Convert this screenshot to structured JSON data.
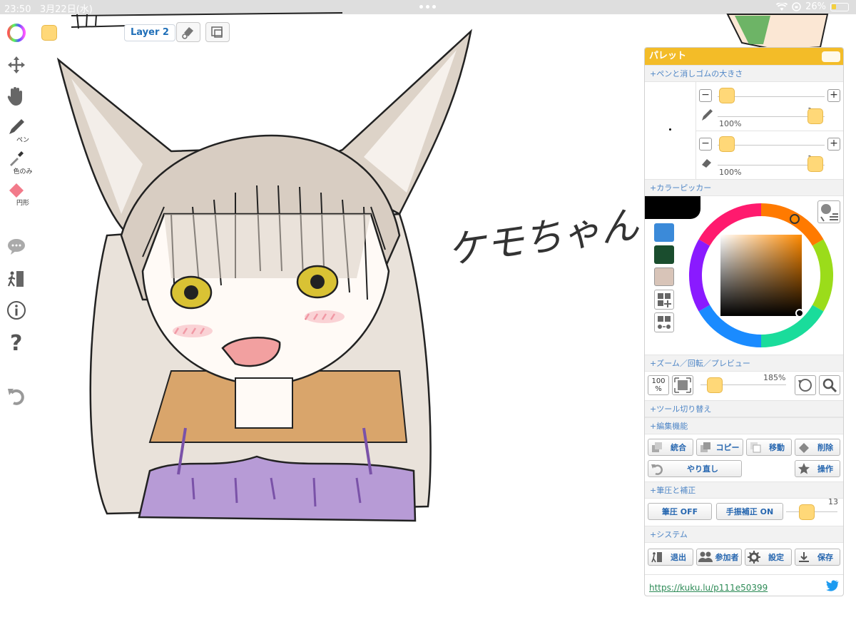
{
  "status": {
    "time": "23:50",
    "date": "3月22日(水)",
    "battery": "26%"
  },
  "toolbar": {
    "layer_label": "Layer 2",
    "color_swatch": "#ffd878"
  },
  "left_tools": {
    "pen_label": "ペン",
    "dropper_label": "色のみ",
    "shape_label": "円形"
  },
  "canvas": {
    "handwriting": "ケモちゃん"
  },
  "palette": {
    "title": "パレット",
    "sections": {
      "pen_size": "+ペンと消しゴムの大きさ",
      "color_picker": "+カラーピッカー",
      "zoom": "+ズーム／回転／プレビュー",
      "tool_switch": "+ツール切り替え",
      "edit": "+編集機能",
      "pressure": "+筆圧と補正",
      "system": "+システム"
    },
    "pen": {
      "size": "1px",
      "opacity": "100%"
    },
    "eraser": {
      "size": "1px",
      "opacity": "100%"
    },
    "colors": {
      "current": "#000000",
      "swatches": [
        "#3b8ad9",
        "#1a4d2e",
        "#d8c4b8"
      ]
    },
    "zoom": {
      "percent_button": "100",
      "percent_sign": "%",
      "value": "185%"
    },
    "edit_buttons": {
      "merge": "統合",
      "copy": "コピー",
      "move": "移動",
      "delete": "削除",
      "redo": "やり直し",
      "operate": "操作"
    },
    "pressure": {
      "pressure_btn": "筆圧 OFF",
      "stabilizer_btn": "手振補正 ON",
      "stabilizer_value": "13"
    },
    "system_buttons": {
      "exit": "退出",
      "participants": "参加者",
      "settings": "設定",
      "save": "保存"
    },
    "link": "https://kuku.lu/p111e50399"
  }
}
